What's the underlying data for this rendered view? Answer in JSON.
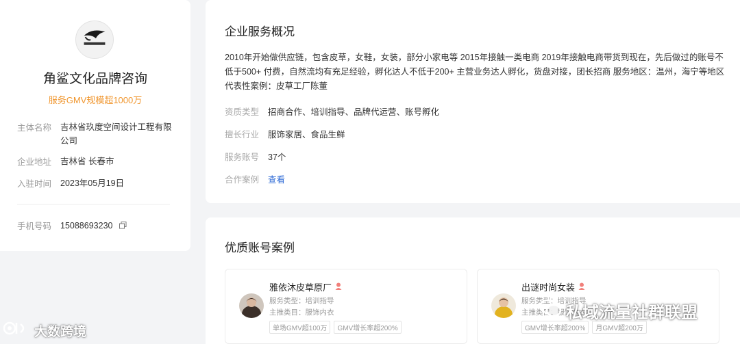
{
  "company": {
    "name": "角鲨文化品牌咨询",
    "gmv_text": "服务GMV规模超1000万",
    "logo_text": "角鲨文化品牌咨询"
  },
  "info": [
    {
      "label": "主体名称",
      "value": "吉林省玖度空间设计工程有限公司"
    },
    {
      "label": "企业地址",
      "value": "吉林省 长春市"
    },
    {
      "label": "入驻时间",
      "value": "2023年05月19日"
    }
  ],
  "phone": {
    "label": "手机号码",
    "value": "15088693230"
  },
  "overview": {
    "title": "企业服务概况",
    "description": "2010年开始做供应链，包含皮草，女鞋，女装，部分小家电等 2015年接触一类电商 2019年接触电商带货到现在，先后做过的账号不低于500+ 付费，自然流均有充足经验，孵化达人不低于200+ 主营业务达人孵化，货盘对接，团长招商 服务地区：温州，海宁等地区 代表性案例：皮草工厂陈董",
    "rows": [
      {
        "label": "资质类型",
        "value": "招商合作、培训指导、品牌代运营、账号孵化"
      },
      {
        "label": "擅长行业",
        "value": "服饰家居、食品生鲜"
      },
      {
        "label": "服务账号",
        "value": "37个"
      },
      {
        "label": "合作案例",
        "value": "查看"
      }
    ]
  },
  "accounts": {
    "title": "优质账号案例",
    "items": [
      {
        "name": "雅依沐皮草原厂",
        "service": "服务类型：培训指导",
        "category": "主推类目：服饰内衣",
        "tags": [
          "单场GMV超100万",
          "GMV增长率超200%"
        ]
      },
      {
        "name": "出谜时尚女装",
        "service": "服务类型：培训指导",
        "category": "主推类目：服饰内衣",
        "tags": [
          "GMV增长率超200%",
          "月GMV超200万"
        ]
      }
    ]
  },
  "watermarks": {
    "left": "大数跨境",
    "right": "私域流量社群联盟"
  },
  "colors": {
    "accent": "#f0962e",
    "link": "#2f6bd6",
    "background": "#f3f4f6"
  }
}
